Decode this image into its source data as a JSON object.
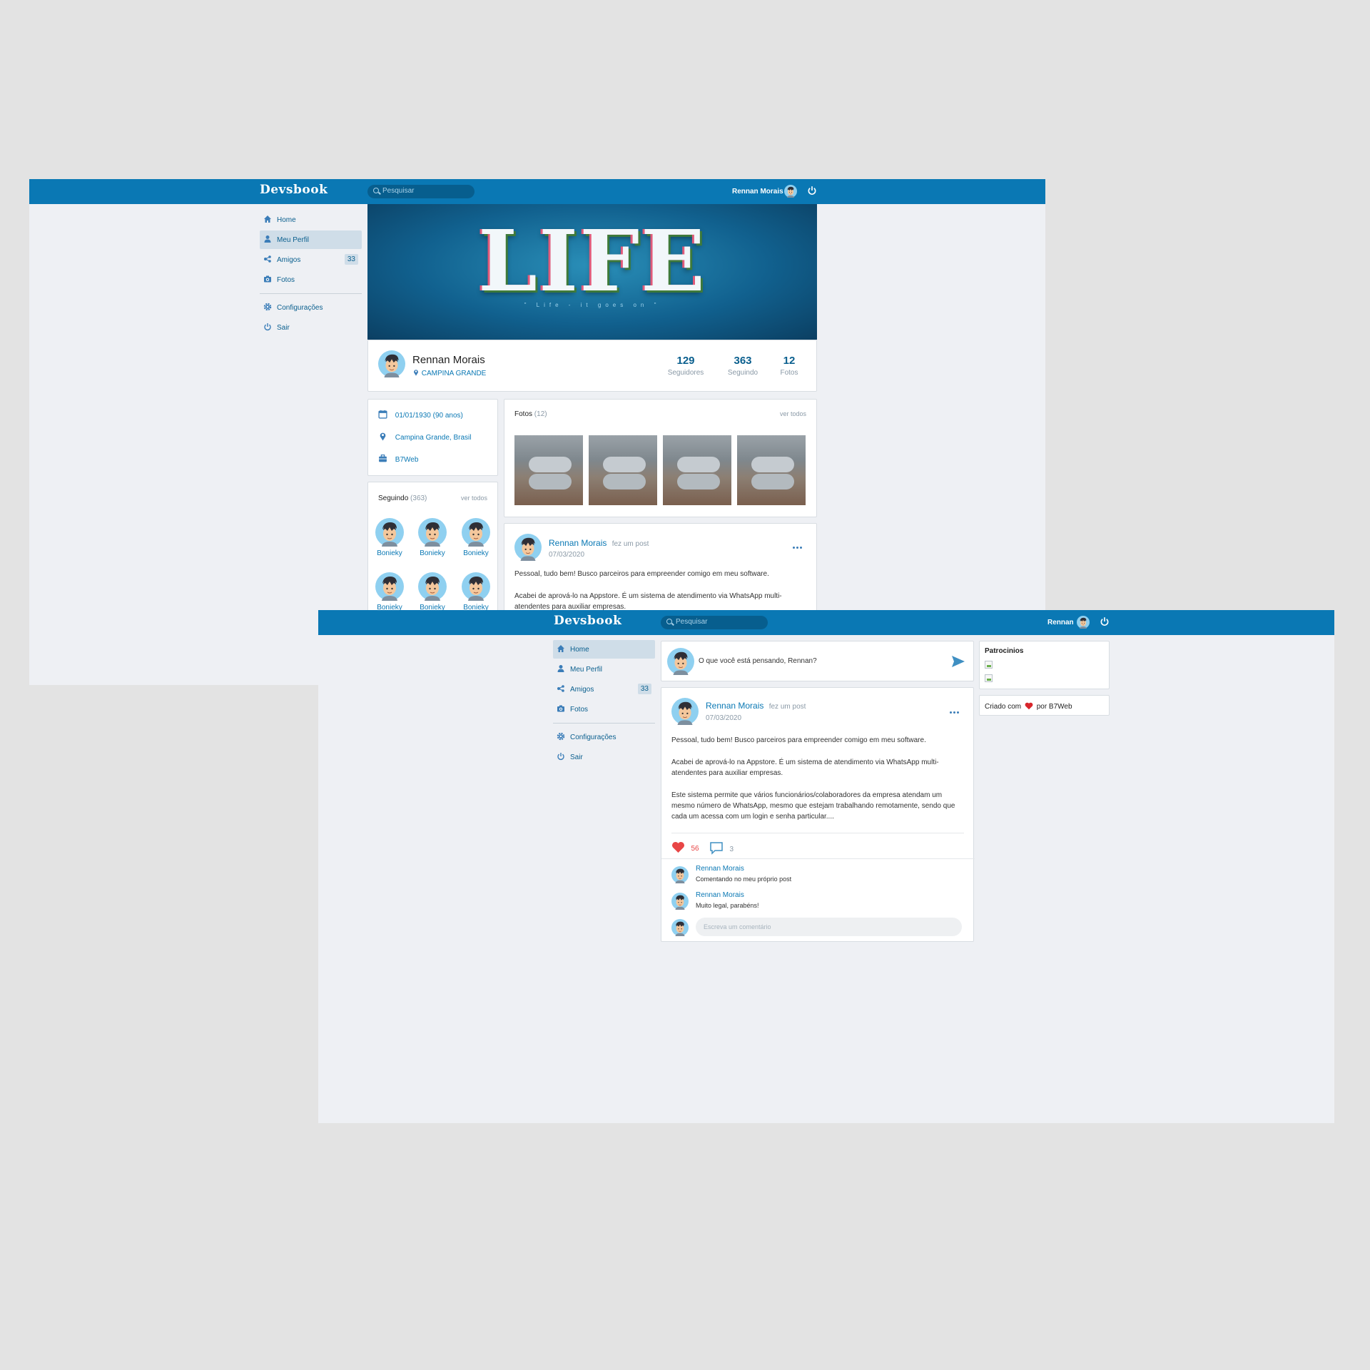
{
  "colors": {
    "brand": "#0a78b4",
    "accent_dark": "#075e8e",
    "like": "#e84646"
  },
  "shot1": {
    "header": {
      "logo": "Devsbook",
      "search_placeholder": "Pesquisar",
      "user_name": "Rennan Morais"
    },
    "sidebar": {
      "items": [
        {
          "label": "Home",
          "icon": "home-icon"
        },
        {
          "label": "Meu Perfil",
          "icon": "user-icon",
          "active": true
        },
        {
          "label": "Amigos",
          "icon": "friends-icon",
          "count": "33"
        },
        {
          "label": "Fotos",
          "icon": "camera-icon"
        }
      ],
      "items2": [
        {
          "label": "Configurações",
          "icon": "gear-icon"
        },
        {
          "label": "Sair",
          "icon": "power-icon"
        }
      ]
    },
    "cover": {
      "title": "LIFE",
      "subtitle": "\" Life - it goes on \""
    },
    "profile": {
      "name": "Rennan Morais",
      "location": "CAMPINA GRANDE",
      "stats": [
        {
          "num": "129",
          "label": "Seguidores"
        },
        {
          "num": "363",
          "label": "Seguindo"
        },
        {
          "num": "12",
          "label": "Fotos"
        }
      ]
    },
    "info": [
      {
        "icon": "calendar-icon",
        "text": "01/01/1930 (90 anos)"
      },
      {
        "icon": "location-icon",
        "text": "Campina Grande, Brasil"
      },
      {
        "icon": "briefcase-icon",
        "text": "B7Web"
      }
    ],
    "following": {
      "title": "Seguindo",
      "count": "(363)",
      "see_all": "ver todos",
      "names": [
        "Bonieky",
        "Bonieky",
        "Bonieky",
        "Bonieky",
        "Bonieky",
        "Bonieky"
      ]
    },
    "photos": {
      "title": "Fotos",
      "count": "(12)",
      "see_all": "ver todos"
    },
    "post": {
      "author": "Rennan Morais",
      "action": "fez um post",
      "date": "07/03/2020",
      "p1": "Pessoal, tudo bem! Busco parceiros para empreender comigo em meu software.",
      "p2": "Acabei de aprová-lo na Appstore. É um sistema de atendimento via WhatsApp multi-atendentes para auxiliar empresas."
    }
  },
  "shot2": {
    "header": {
      "logo": "Devsbook",
      "search_placeholder": "Pesquisar",
      "user_name": "Rennan"
    },
    "sidebar": {
      "items": [
        {
          "label": "Home",
          "icon": "home-icon",
          "active": true
        },
        {
          "label": "Meu Perfil",
          "icon": "user-icon"
        },
        {
          "label": "Amigos",
          "icon": "friends-icon",
          "count": "33"
        },
        {
          "label": "Fotos",
          "icon": "camera-icon"
        }
      ],
      "items2": [
        {
          "label": "Configurações",
          "icon": "gear-icon"
        },
        {
          "label": "Sair",
          "icon": "power-icon"
        }
      ]
    },
    "composer": {
      "placeholder": "O que você está pensando, Rennan?"
    },
    "post": {
      "author": "Rennan Morais",
      "action": "fez um post",
      "date": "07/03/2020",
      "p1": "Pessoal, tudo bem! Busco parceiros para empreender comigo em meu software.",
      "p2": "Acabei de aprová-lo na Appstore. É um sistema de atendimento via WhatsApp multi-atendentes para auxiliar empresas.",
      "p3": "Este sistema permite que vários funcionários/colaboradores da empresa atendam um mesmo número de WhatsApp, mesmo que estejam trabalhando remotamente, sendo que cada um acessa com um login e senha particular....",
      "likes": "56",
      "comments_count": "3",
      "comments": [
        {
          "author": "Rennan Morais",
          "text": "Comentando no meu próprio post"
        },
        {
          "author": "Rennan Morais",
          "text": "Muito legal, parabéns!"
        }
      ],
      "comment_placeholder": "Escreva um comentário"
    },
    "sponsors": {
      "title": "Patrocinios"
    },
    "footer": {
      "prefix": "Criado com",
      "suffix": "por B7Web"
    }
  }
}
